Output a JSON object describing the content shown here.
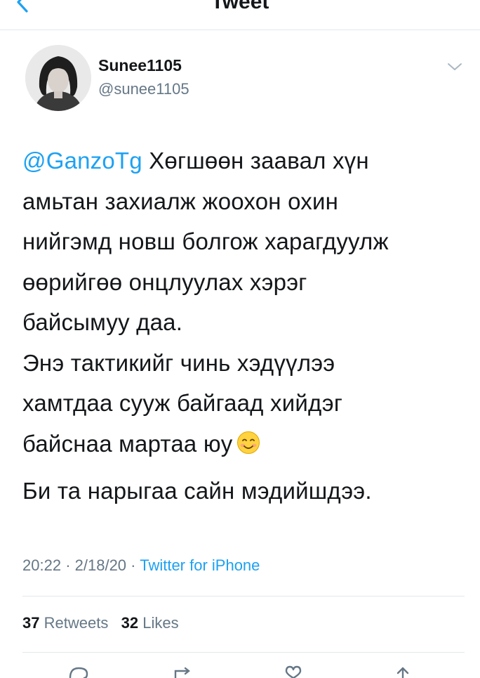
{
  "header": {
    "title": "Tweet",
    "back_icon": "chevron-left-icon"
  },
  "author": {
    "display_name": "Sunee1105",
    "handle": "@sunee1105",
    "menu_icon": "chevron-down-icon"
  },
  "tweet": {
    "mention": "@GanzoTg",
    "lines_p1": [
      " Хөгшөөн заавал хүн",
      "амьтан захиалж жоохон охин",
      "нийгэмд новш болгож харагдуулж",
      "өөрийгөө онцлуулах хэрэг",
      "байсымуу даа.",
      "Энэ тактикийг чинь хэдүүлээ",
      "хамтдаа сууж байгаад хийдэг",
      "байснаа мартаа юу"
    ],
    "emoji": "smiling-face-emoji",
    "line_p2": "Би та нарыгаа сайн мэдийшдээ."
  },
  "meta": {
    "time": "20:22",
    "date": "2/18/20",
    "separator": "·",
    "source": "Twitter for iPhone"
  },
  "stats": {
    "retweets_count": "37",
    "retweets_label": "Retweets",
    "likes_count": "32",
    "likes_label": "Likes"
  },
  "actions": [
    "reply-icon",
    "retweet-icon",
    "like-icon",
    "share-icon"
  ],
  "colors": {
    "link": "#1da1f2",
    "secondary_text": "#657786",
    "divider": "#e1e8ed"
  }
}
